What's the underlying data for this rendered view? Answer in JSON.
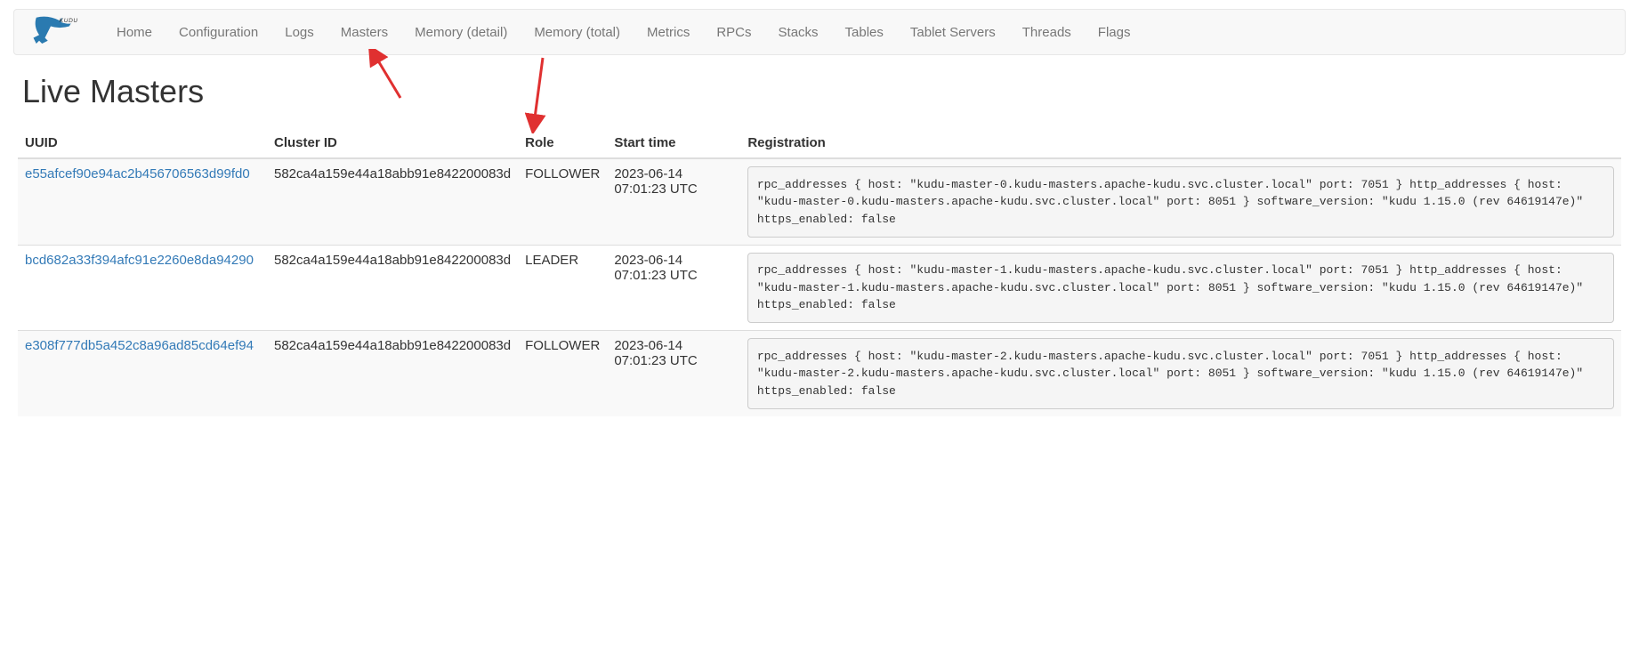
{
  "brand": "KUDU",
  "nav": [
    {
      "label": "Home"
    },
    {
      "label": "Configuration"
    },
    {
      "label": "Logs"
    },
    {
      "label": "Masters"
    },
    {
      "label": "Memory (detail)"
    },
    {
      "label": "Memory (total)"
    },
    {
      "label": "Metrics"
    },
    {
      "label": "RPCs"
    },
    {
      "label": "Stacks"
    },
    {
      "label": "Tables"
    },
    {
      "label": "Tablet Servers"
    },
    {
      "label": "Threads"
    },
    {
      "label": "Flags"
    }
  ],
  "page_title": "Live Masters",
  "columns": {
    "uuid": "UUID",
    "cluster_id": "Cluster ID",
    "role": "Role",
    "start_time": "Start time",
    "registration": "Registration"
  },
  "rows": [
    {
      "uuid": "e55afcef90e94ac2b456706563d99fd0",
      "cluster_id": "582ca4a159e44a18abb91e842200083d",
      "role": "FOLLOWER",
      "start_time": "2023-06-14 07:01:23 UTC",
      "registration": "rpc_addresses { host: \"kudu-master-0.kudu-masters.apache-kudu.svc.cluster.local\" port: 7051 } http_addresses { host: \"kudu-master-0.kudu-masters.apache-kudu.svc.cluster.local\" port: 8051 } software_version: \"kudu 1.15.0 (rev 64619147e)\" https_enabled: false"
    },
    {
      "uuid": "bcd682a33f394afc91e2260e8da94290",
      "cluster_id": "582ca4a159e44a18abb91e842200083d",
      "role": "LEADER",
      "start_time": "2023-06-14 07:01:23 UTC",
      "registration": "rpc_addresses { host: \"kudu-master-1.kudu-masters.apache-kudu.svc.cluster.local\" port: 7051 } http_addresses { host: \"kudu-master-1.kudu-masters.apache-kudu.svc.cluster.local\" port: 8051 } software_version: \"kudu 1.15.0 (rev 64619147e)\" https_enabled: false"
    },
    {
      "uuid": "e308f777db5a452c8a96ad85cd64ef94",
      "cluster_id": "582ca4a159e44a18abb91e842200083d",
      "role": "FOLLOWER",
      "start_time": "2023-06-14 07:01:23 UTC",
      "registration": "rpc_addresses { host: \"kudu-master-2.kudu-masters.apache-kudu.svc.cluster.local\" port: 7051 } http_addresses { host: \"kudu-master-2.kudu-masters.apache-kudu.svc.cluster.local\" port: 8051 } software_version: \"kudu 1.15.0 (rev 64619147e)\" https_enabled: false"
    }
  ],
  "annotations": {
    "arrow1_target": "Masters",
    "arrow2_target": "Role"
  }
}
